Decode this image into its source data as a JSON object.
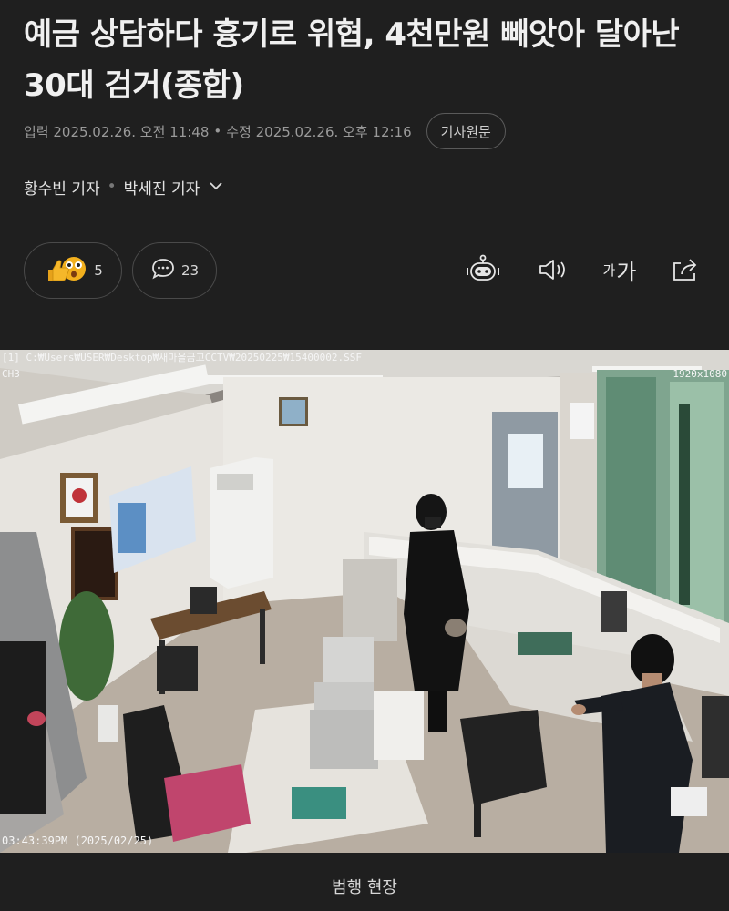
{
  "article": {
    "headline": "예금 상담하다 흉기로 위협, 4천만원 빼앗아 달아난 30대 검거(종합)",
    "published": "입력 2025.02.26. 오전 11:48",
    "updated": "수정 2025.02.26. 오후 12:16",
    "meta_separator": "•",
    "original_button": "기사원문",
    "reporters": [
      "황수빈 기자",
      "박세진 기자"
    ],
    "reporter_separator": "•"
  },
  "actions": {
    "reaction_count": "5",
    "comment_count": "23",
    "font_small": "가",
    "font_big": "가"
  },
  "icons": {
    "reactions": "thumbs-up-and-surprised-emoji-icon",
    "comments": "speech-bubble-icon",
    "ai_summary": "robot-icon",
    "text_to_speech": "speaker-icon",
    "font_size": "font-size-icon",
    "share": "share-icon",
    "reporter_dropdown": "chevron-down-icon"
  },
  "photo": {
    "overlay_path": "[1] C:₩Users₩USER₩Desktop₩새마을금고CCTV₩20250225₩15400002.SSF",
    "overlay_channel": "CH3",
    "overlay_resolution": "1920x1080",
    "overlay_timestamp": "03:43:39PM (2025/02/25)"
  },
  "caption": "범행 현장",
  "colors": {
    "background": "#1f1f1f",
    "text_primary": "#f0f0f0",
    "text_secondary": "#9a9a9a",
    "pill_border": "#4a4a4a"
  }
}
